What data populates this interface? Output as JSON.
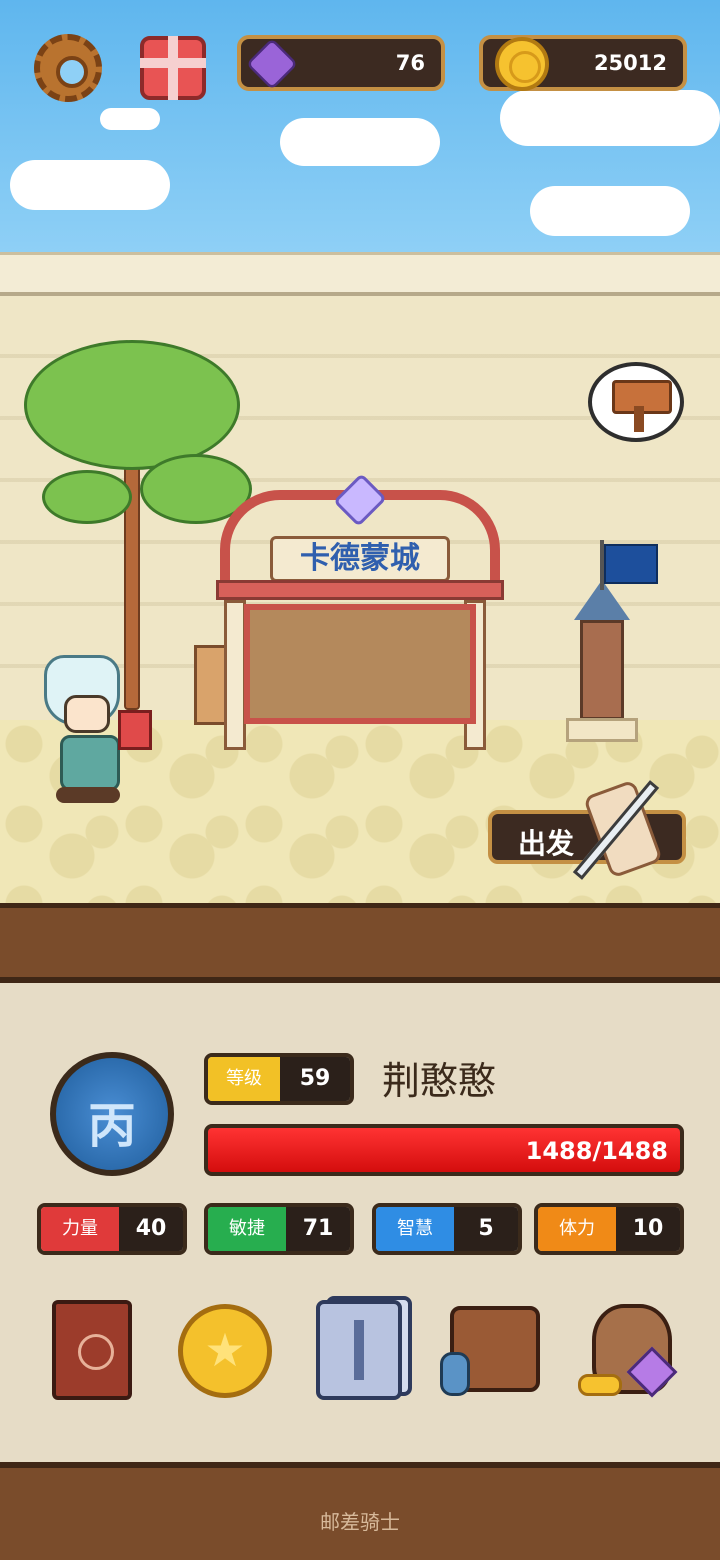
{
  "topbar": {
    "gems": "76",
    "gold": "25012",
    "settings_icon": "gear-icon",
    "gift_icon": "gift-icon"
  },
  "scene": {
    "town_sign": "卡德蒙城",
    "depart_label": "出发"
  },
  "hero": {
    "rank": "丙",
    "level_label": "等级",
    "level": "59",
    "name": "荆憨憨",
    "hp_text": "1488/1488",
    "hp_fraction": 1.0
  },
  "stats": [
    {
      "label": "力量",
      "value": "40",
      "color": "#e03a3a"
    },
    {
      "label": "敏捷",
      "value": "71",
      "color": "#27ae4f"
    },
    {
      "label": "智慧",
      "value": "5",
      "color": "#2f8de4"
    },
    {
      "label": "体力",
      "value": "10",
      "color": "#f08a17"
    }
  ],
  "menu": [
    {
      "icon": "hero-book-icon"
    },
    {
      "icon": "star-medal-icon"
    },
    {
      "icon": "card-deck-icon"
    },
    {
      "icon": "backpack-icon"
    },
    {
      "icon": "treasure-sack-icon"
    }
  ],
  "footer": {
    "title": "邮差骑士"
  }
}
